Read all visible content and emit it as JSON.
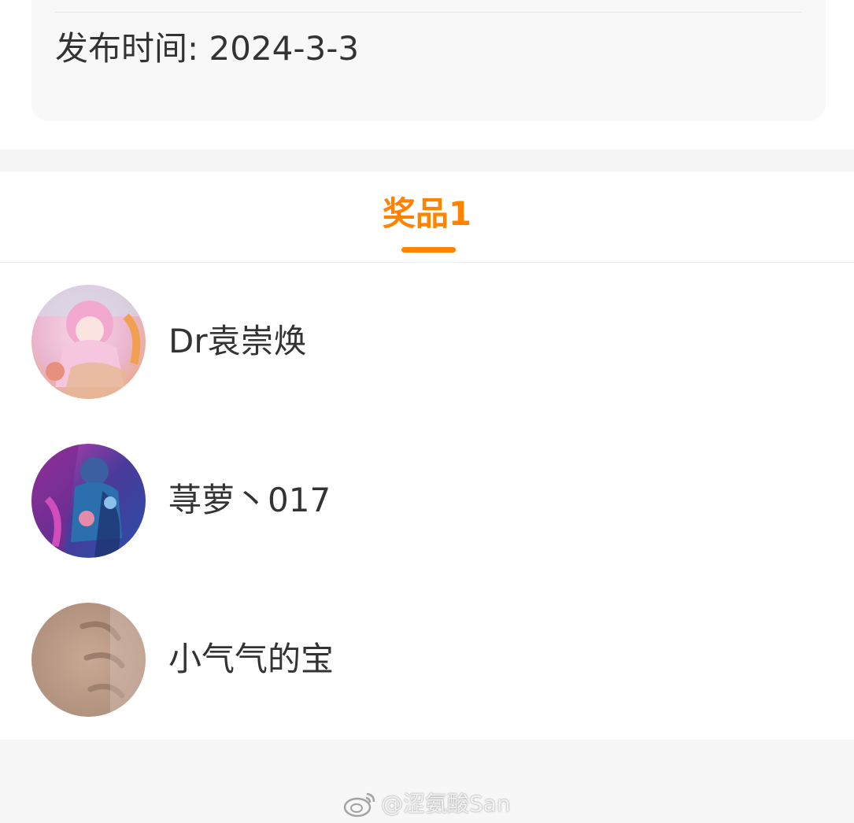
{
  "publish": {
    "label": "发布时间: 2024-3-3"
  },
  "tabs": [
    {
      "label": "奖品1",
      "active": true
    }
  ],
  "winners": [
    {
      "name": "Dr袁崇焕",
      "avatar": "anime-pink-hair-avatar"
    },
    {
      "name": "荨萝丶017",
      "avatar": "anime-purple-character-avatar"
    },
    {
      "name": "小气气的宝",
      "avatar": "hand-photo-avatar"
    }
  ],
  "watermark": {
    "text": "@涩氨酸San",
    "logo": "weibo-logo-icon"
  },
  "colors": {
    "accent": "#ff8200",
    "text": "#333333",
    "card_bg": "#f8f8f8",
    "page_bg": "#f5f5f5"
  }
}
